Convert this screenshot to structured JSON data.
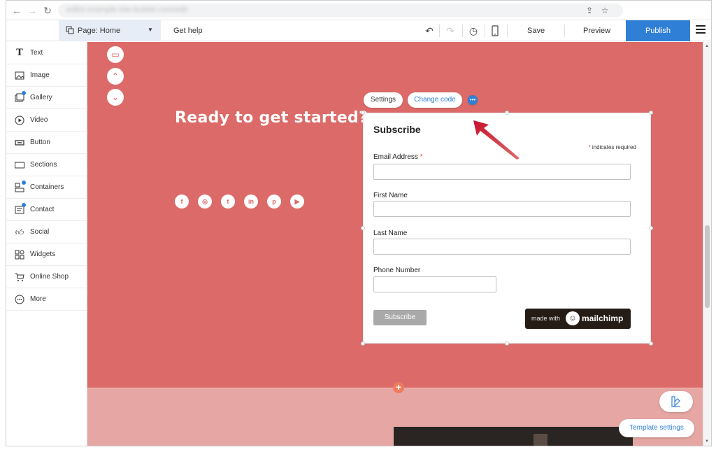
{
  "browser": {
    "address": "editor.example-site-builder.com/edit"
  },
  "toolbar": {
    "page_label": "Page: Home",
    "get_help": "Get help",
    "save": "Save",
    "preview": "Preview",
    "publish": "Publish"
  },
  "sidebar": {
    "items": [
      {
        "label": "Text",
        "icon": "text-icon"
      },
      {
        "label": "Image",
        "icon": "image-icon"
      },
      {
        "label": "Gallery",
        "icon": "gallery-icon"
      },
      {
        "label": "Video",
        "icon": "video-icon"
      },
      {
        "label": "Button",
        "icon": "button-icon"
      },
      {
        "label": "Sections",
        "icon": "sections-icon"
      },
      {
        "label": "Containers",
        "icon": "containers-icon"
      },
      {
        "label": "Contact",
        "icon": "contact-icon"
      },
      {
        "label": "Social",
        "icon": "thumbs-up-icon"
      },
      {
        "label": "Widgets",
        "icon": "widgets-icon"
      },
      {
        "label": "Online Shop",
        "icon": "cart-icon"
      },
      {
        "label": "More",
        "icon": "more-icon"
      }
    ]
  },
  "canvas": {
    "headline": "Ready to get started?",
    "social_icons": [
      "facebook-icon",
      "instagram-icon",
      "twitter-icon",
      "linkedin-icon",
      "pinterest-icon",
      "youtube-icon"
    ],
    "background_color": "#db6a68"
  },
  "widget_toolbar": {
    "settings": "Settings",
    "change_code": "Change code"
  },
  "form": {
    "title": "Subscribe",
    "required_note": "indicates required",
    "required_star": "*",
    "fields": [
      {
        "label": "Email Address",
        "required": true,
        "value": ""
      },
      {
        "label": "First Name",
        "required": false,
        "value": ""
      },
      {
        "label": "Last Name",
        "required": false,
        "value": ""
      },
      {
        "label": "Phone Number",
        "required": false,
        "value": ""
      }
    ],
    "submit": "Subscribe",
    "badge_made_with": "made with",
    "badge_brand": "mailchimp"
  },
  "floating": {
    "template_settings": "Template settings"
  },
  "colors": {
    "accent": "#2f7fd6",
    "section": "#db6a68",
    "arrow": "#c8102e"
  }
}
